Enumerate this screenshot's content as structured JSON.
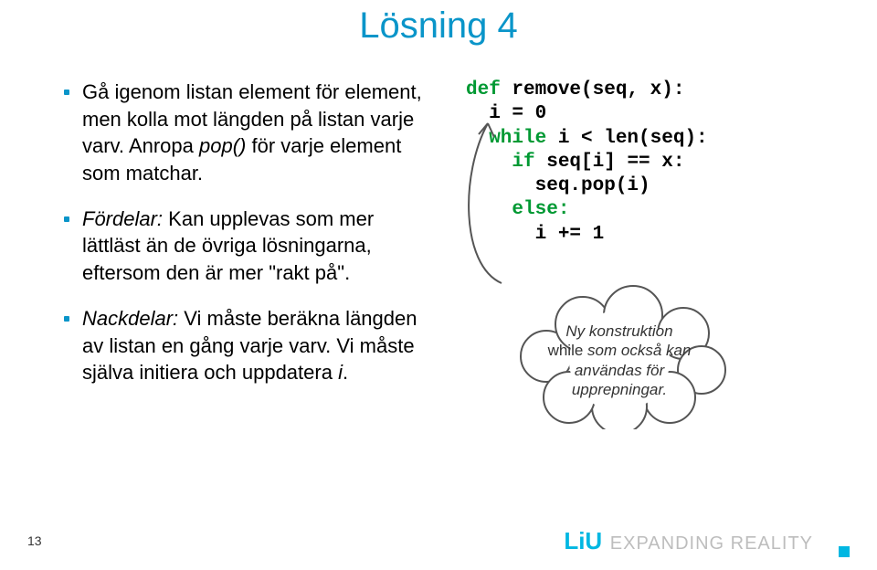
{
  "title": "Lösning 4",
  "bullets": [
    {
      "pre": "Gå igenom listan element för element, men kolla mot längden på listan varje varv. Anropa ",
      "ital": "pop()",
      "post": " för varje element som matchar."
    },
    {
      "pre": "",
      "ital": "Fördelar:",
      "post": " Kan upplevas som mer lättläst än de övriga lösningarna, eftersom den är mer \"rakt på\"."
    },
    {
      "pre": "",
      "ital": "Nackdelar:",
      "post": " Vi måste beräkna längden av listan en gång varje varv. Vi måste själva initiera och uppdatera ",
      "ital2": "i",
      "post2": "."
    }
  ],
  "code": {
    "l1a": "def ",
    "l1b": "remove(seq, x):",
    "l2": "  i = 0",
    "l3a": "  while",
    "l3b": " i < len(seq):",
    "l4a": "    if",
    "l4b": " seq[i] == x:",
    "l5": "      seq.pop(i)",
    "l6": "    else:",
    "l7": "      i += 1"
  },
  "cloud": {
    "a": "Ny konstruktion",
    "b": "while",
    "c": " som också kan användas för upprepningar."
  },
  "footer": {
    "logo": "LiU",
    "tag": "EXPANDING REALITY"
  },
  "page": "13"
}
